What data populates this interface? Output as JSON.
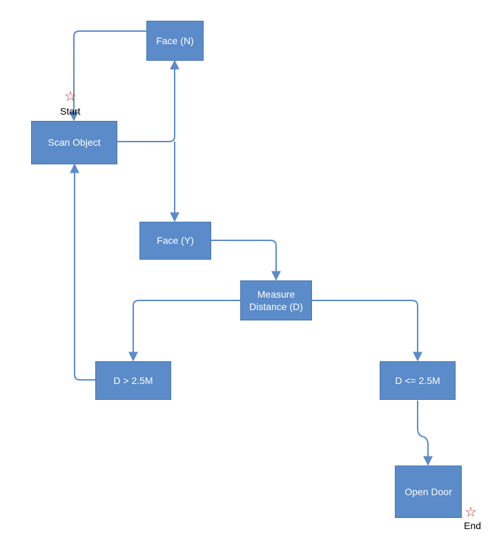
{
  "labels": {
    "start": "Start",
    "end": "End"
  },
  "nodes": {
    "face_n": "Face (N)",
    "scan_object": "Scan Object",
    "face_y": "Face (Y)",
    "measure_distance": "Measure Distance (D)",
    "d_gt": "D > 2.5M",
    "d_lte": "D <= 2.5M",
    "open_door": "Open Door"
  },
  "colors": {
    "node_fill": "#5b8bc9",
    "node_border": "#4a76b0",
    "node_text": "#ffffff",
    "connector": "#5b8bc9",
    "star": "#c62828"
  },
  "diagram": {
    "type": "flowchart",
    "description": "Access control flow: scan object, detect face, measure distance, open door if within 2.5M",
    "nodes": [
      {
        "id": "scan_object",
        "label": "Scan Object",
        "start": true
      },
      {
        "id": "face_n",
        "label": "Face (N)"
      },
      {
        "id": "face_y",
        "label": "Face (Y)"
      },
      {
        "id": "measure_distance",
        "label": "Measure Distance (D)"
      },
      {
        "id": "d_gt",
        "label": "D > 2.5M"
      },
      {
        "id": "d_lte",
        "label": "D <= 2.5M"
      },
      {
        "id": "open_door",
        "label": "Open Door",
        "end": true
      }
    ],
    "edges": [
      {
        "from": "scan_object",
        "to": "face_n"
      },
      {
        "from": "face_n",
        "to": "scan_object"
      },
      {
        "from": "scan_object",
        "to": "face_y"
      },
      {
        "from": "face_y",
        "to": "measure_distance"
      },
      {
        "from": "measure_distance",
        "to": "d_gt"
      },
      {
        "from": "measure_distance",
        "to": "d_lte"
      },
      {
        "from": "d_gt",
        "to": "scan_object"
      },
      {
        "from": "d_lte",
        "to": "open_door"
      }
    ]
  }
}
